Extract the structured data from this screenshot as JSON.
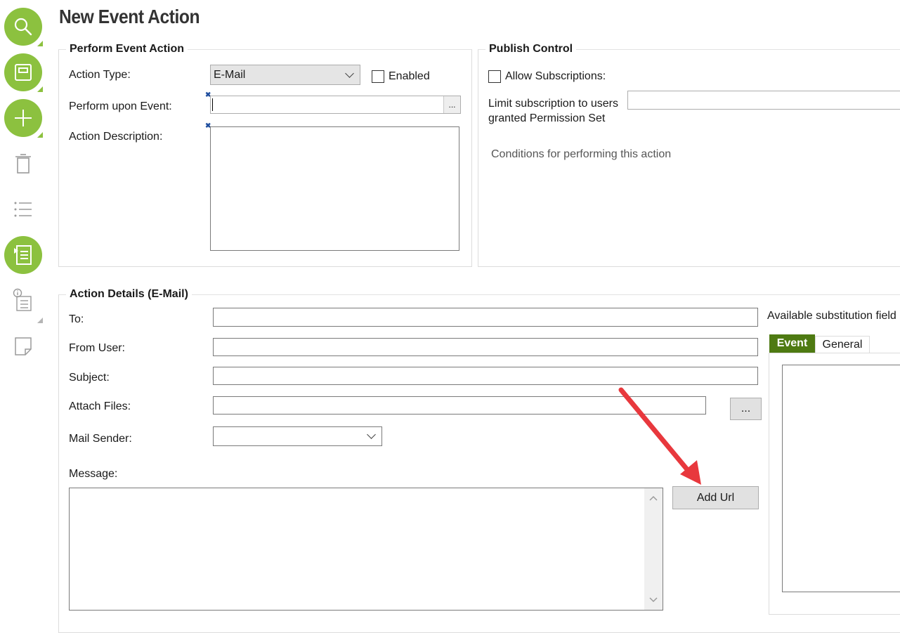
{
  "page": {
    "title": "New Event Action"
  },
  "toolbar": {
    "items": [
      {
        "name": "search-icon"
      },
      {
        "name": "save-icon"
      },
      {
        "name": "add-icon"
      },
      {
        "name": "delete-icon"
      },
      {
        "name": "list-icon"
      },
      {
        "name": "event-list-icon"
      },
      {
        "name": "info-list-icon"
      },
      {
        "name": "note-icon"
      }
    ]
  },
  "perform_event_action": {
    "legend": "Perform Event Action",
    "action_type_label": "Action Type:",
    "action_type_value": "E-Mail",
    "enabled_label": "Enabled",
    "enabled_checked": false,
    "perform_upon_event_label": "Perform upon Event:",
    "perform_upon_event_value": "",
    "browse_label": "...",
    "action_description_label": "Action Description:",
    "action_description_value": ""
  },
  "publish_control": {
    "legend": "Publish Control",
    "allow_subscriptions_label": "Allow Subscriptions:",
    "allow_subscriptions_checked": false,
    "limit_subscription_label": "Limit subscription to users granted Permission Set",
    "limit_subscription_value": "",
    "conditions_text": "Conditions for performing this action"
  },
  "action_details": {
    "legend": "Action Details (E-Mail)",
    "to_label": "To:",
    "to_value": "",
    "from_user_label": "From User:",
    "from_user_value": "",
    "subject_label": "Subject:",
    "subject_value": "",
    "attach_files_label": "Attach Files:",
    "attach_files_value": "",
    "attach_browse_label": "...",
    "mail_sender_label": "Mail Sender:",
    "mail_sender_value": "",
    "message_label": "Message:",
    "message_value": "",
    "add_url_label": "Add Url"
  },
  "substitution": {
    "label": "Available substitution field",
    "tabs": [
      {
        "label": "Event",
        "active": true
      },
      {
        "label": "General",
        "active": false
      }
    ]
  },
  "colors": {
    "toolbar_accent": "#8cc13f",
    "active_tab": "#4e7a12",
    "annotation_arrow": "#e8383d"
  }
}
